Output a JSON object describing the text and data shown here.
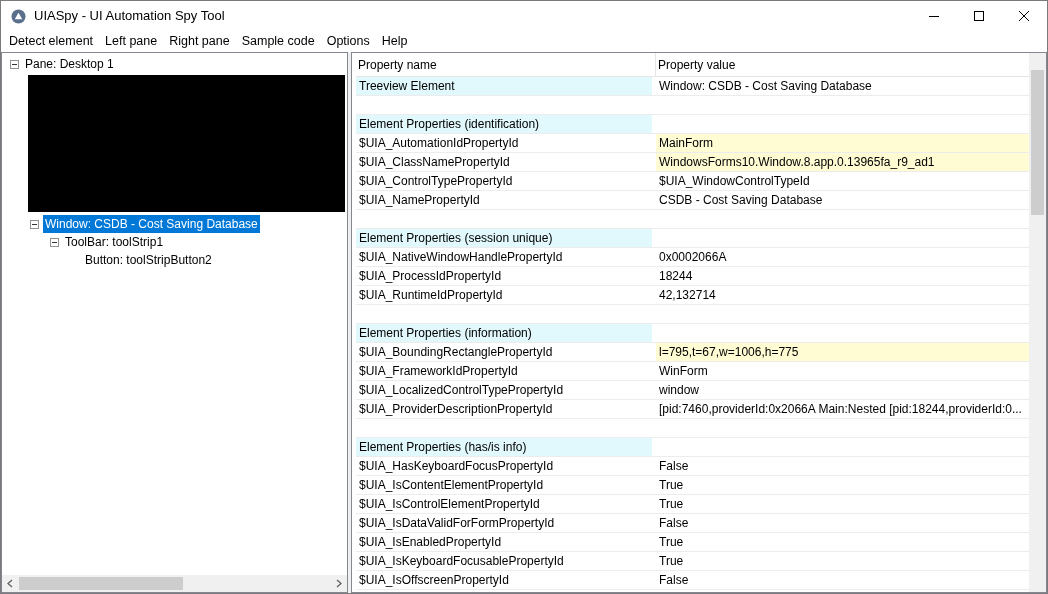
{
  "window": {
    "title": "UIASpy - UI Automation Spy Tool"
  },
  "menu": [
    "Detect element",
    "Left pane",
    "Right pane",
    "Sample code",
    "Options",
    "Help"
  ],
  "tree": [
    {
      "label": "Pane: Desktop 1",
      "expanded": true,
      "selected": false,
      "children": [
        {
          "label": "Window: CSDB - Cost Saving Database",
          "expanded": true,
          "selected": true,
          "children": [
            {
              "label": "ToolBar: toolStrip1",
              "expanded": true,
              "selected": false,
              "children": [
                {
                  "label": "Button: toolStripButton2",
                  "selected": false
                }
              ]
            }
          ]
        }
      ]
    }
  ],
  "table": {
    "columns": [
      "Property name",
      "Property value"
    ],
    "rows": [
      {
        "kind": "section",
        "name": "Treeview Element",
        "value": "Window: CSDB - Cost Saving Database"
      },
      {
        "kind": "blank"
      },
      {
        "kind": "section",
        "name": "Element Properties (identification)"
      },
      {
        "kind": "property",
        "name": "$UIA_AutomationIdPropertyId",
        "value": "MainForm",
        "highlighted": true
      },
      {
        "kind": "property",
        "name": "$UIA_ClassNamePropertyId",
        "value": "WindowsForms10.Window.8.app.0.13965fa_r9_ad1",
        "highlighted": true
      },
      {
        "kind": "property",
        "name": "$UIA_ControlTypePropertyId",
        "value": "$UIA_WindowControlTypeId",
        "highlighted": false
      },
      {
        "kind": "property",
        "name": "$UIA_NamePropertyId",
        "value": "CSDB - Cost Saving Database",
        "highlighted": false
      },
      {
        "kind": "blank"
      },
      {
        "kind": "section",
        "name": "Element Properties (session unique)"
      },
      {
        "kind": "property",
        "name": "$UIA_NativeWindowHandlePropertyId",
        "value": "0x0002066A",
        "highlighted": false
      },
      {
        "kind": "property",
        "name": "$UIA_ProcessIdPropertyId",
        "value": "18244",
        "highlighted": false
      },
      {
        "kind": "property",
        "name": "$UIA_RuntimeIdPropertyId",
        "value": "42,132714",
        "highlighted": false
      },
      {
        "kind": "blank"
      },
      {
        "kind": "section",
        "name": "Element Properties (information)"
      },
      {
        "kind": "property",
        "name": "$UIA_BoundingRectanglePropertyId",
        "value": "l=795,t=67,w=1006,h=775",
        "highlighted": true
      },
      {
        "kind": "property",
        "name": "$UIA_FrameworkIdPropertyId",
        "value": "WinForm",
        "highlighted": false
      },
      {
        "kind": "property",
        "name": "$UIA_LocalizedControlTypePropertyId",
        "value": "window",
        "highlighted": false
      },
      {
        "kind": "property",
        "name": "$UIA_ProviderDescriptionPropertyId",
        "value": "[pid:7460,providerId:0x2066A Main:Nested [pid:18244,providerId:0...",
        "highlighted": false
      },
      {
        "kind": "blank"
      },
      {
        "kind": "section",
        "name": "Element Properties (has/is info)"
      },
      {
        "kind": "property",
        "name": "$UIA_HasKeyboardFocusPropertyId",
        "value": "False",
        "highlighted": false
      },
      {
        "kind": "property",
        "name": "$UIA_IsContentElementPropertyId",
        "value": "True",
        "highlighted": false
      },
      {
        "kind": "property",
        "name": "$UIA_IsControlElementPropertyId",
        "value": "True",
        "highlighted": false
      },
      {
        "kind": "property",
        "name": "$UIA_IsDataValidForFormPropertyId",
        "value": "False",
        "highlighted": false
      },
      {
        "kind": "property",
        "name": "$UIA_IsEnabledPropertyId",
        "value": "True",
        "highlighted": false
      },
      {
        "kind": "property",
        "name": "$UIA_IsKeyboardFocusablePropertyId",
        "value": "True",
        "highlighted": false
      },
      {
        "kind": "property",
        "name": "$UIA_IsOffscreenPropertyId",
        "value": "False",
        "highlighted": false
      }
    ]
  }
}
